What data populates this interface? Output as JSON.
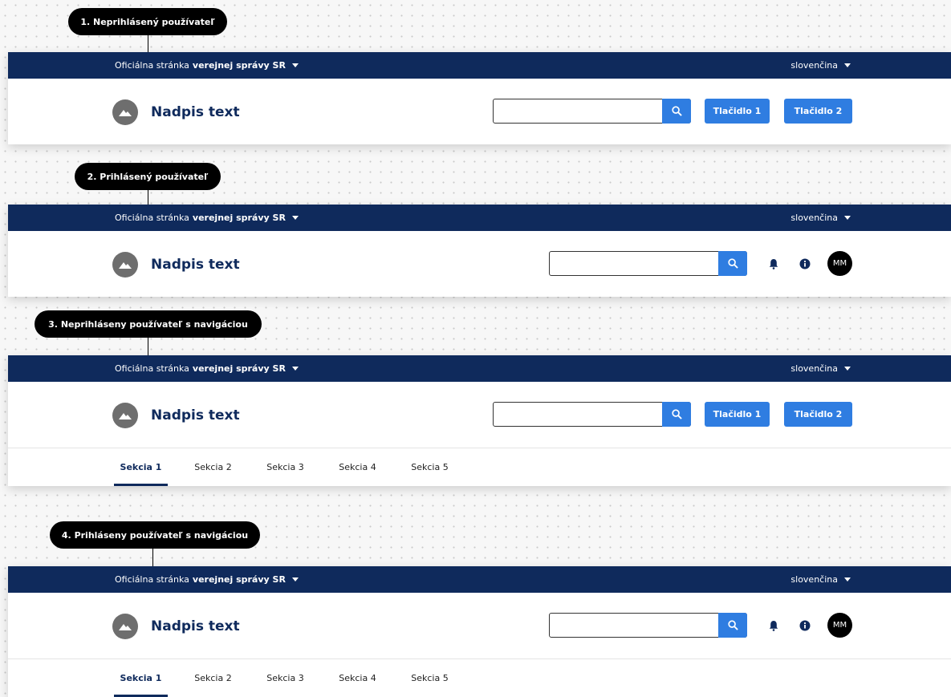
{
  "variants": [
    {
      "label": "1. Neprihlásený používateľ",
      "official_prefix": "Oficiálna stránka",
      "official_bold": "verejnej správy SR",
      "language": "slovenčina",
      "title": "Nadpis text",
      "button1": "Tlačidlo 1",
      "button2": "Tlačidlo 2"
    },
    {
      "label": "2. Prihlásený používateľ",
      "official_prefix": "Oficiálna stránka",
      "official_bold": "verejnej správy SR",
      "language": "slovenčina",
      "title": "Nadpis text",
      "avatar": "MM"
    },
    {
      "label": "3. Neprihláseny používateľ s navigáciou",
      "official_prefix": "Oficiálna stránka",
      "official_bold": "verejnej správy SR",
      "language": "slovenčina",
      "title": "Nadpis text",
      "button1": "Tlačidlo 1",
      "button2": "Tlačidlo 2",
      "nav": [
        "Sekcia 1",
        "Sekcia 2",
        "Sekcia 3",
        "Sekcia 4",
        "Sekcia 5"
      ]
    },
    {
      "label": "4. Prihláseny používateľ s navigáciou",
      "official_prefix": "Oficiálna stránka",
      "official_bold": "verejnej správy SR",
      "language": "slovenčina",
      "title": "Nadpis text",
      "avatar": "MM",
      "nav": [
        "Sekcia 1",
        "Sekcia 2",
        "Sekcia 3",
        "Sekcia 4",
        "Sekcia 5"
      ]
    }
  ],
  "colors": {
    "brand_navy": "#0f2a5c",
    "primary_button": "#2f7de1",
    "logo_gray": "#6e6e6e",
    "avatar_bg": "#000000"
  },
  "icons": [
    "mountain-logo-icon",
    "search-icon",
    "caret-down-icon",
    "bell-icon",
    "info-icon"
  ]
}
